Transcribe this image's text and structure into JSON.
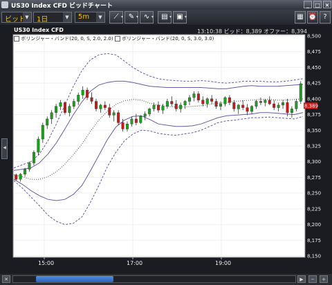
{
  "window": {
    "title": "US30 Index CFD ビッドチャート"
  },
  "toolbar": {
    "price_type": "ビッド",
    "period": "1日",
    "interval": "5m",
    "tools": [
      "trendline-tool",
      "pin-tool",
      "indicator-tool",
      "print-tool",
      "image-tool"
    ]
  },
  "chart": {
    "symbol": "US30 Index CFD",
    "time": "13:10:38",
    "bid": "ビッド：8,389",
    "offer": "オファー：8,394",
    "legend": [
      "ボリンジャー・バンド(20, 0, S, 2.0, 2.0)",
      "ボリンジャー・バンド(20, 0, S, 3.0, 3.0)"
    ],
    "current_price_label": "8,389"
  },
  "chart_data": {
    "type": "candlestick",
    "ylim": [
      8150,
      8500
    ],
    "yticks": [
      "8,500",
      "8,475",
      "8,450",
      "8,425",
      "8,400",
      "8,375",
      "8,350",
      "8,325",
      "8,300",
      "8,275",
      "8,250",
      "8,225",
      "8,200",
      "8,175",
      "8,150"
    ],
    "xticks": [
      "15:00",
      "17:00",
      "19:00"
    ],
    "series": [
      {
        "name": "BB 2.0 upper",
        "values": [
          8286,
          8288,
          8290,
          8298,
          8312,
          8330,
          8352,
          8375,
          8395,
          8412,
          8422,
          8426,
          8428,
          8428,
          8426,
          8423,
          8420,
          8419,
          8418,
          8418,
          8418,
          8418,
          8418,
          8417,
          8416,
          8416,
          8418,
          8420,
          8421,
          8420,
          8420,
          8420,
          8421,
          8422,
          8423
        ]
      },
      {
        "name": "BB 2.0 lower",
        "values": [
          8272,
          8264,
          8254,
          8246,
          8240,
          8238,
          8240,
          8248,
          8262,
          8285,
          8310,
          8335,
          8355,
          8366,
          8372,
          8373,
          8367,
          8360,
          8358,
          8356,
          8356,
          8357,
          8360,
          8365,
          8370,
          8373,
          8374,
          8375,
          8376,
          8378,
          8378,
          8377,
          8376,
          8375,
          8378
        ]
      },
      {
        "name": "BB 3.0 upper",
        "values": [
          8290,
          8295,
          8300,
          8312,
          8333,
          8360,
          8390,
          8420,
          8445,
          8462,
          8470,
          8472,
          8470,
          8460,
          8450,
          8442,
          8436,
          8432,
          8430,
          8429,
          8428,
          8428,
          8429,
          8428,
          8426,
          8425,
          8426,
          8428,
          8428,
          8428,
          8427,
          8427,
          8428,
          8430,
          8432
        ]
      },
      {
        "name": "BB 3.0 lower",
        "values": [
          8270,
          8258,
          8244,
          8230,
          8215,
          8205,
          8200,
          8202,
          8212,
          8235,
          8262,
          8292,
          8315,
          8333,
          8344,
          8350,
          8349,
          8345,
          8343,
          8342,
          8344,
          8346,
          8350,
          8356,
          8362,
          8365,
          8366,
          8368,
          8370,
          8370,
          8371,
          8370,
          8369,
          8368,
          8372
        ]
      },
      {
        "name": "BB middle",
        "values": [
          8279,
          8276,
          8272,
          8272,
          8276,
          8284,
          8296,
          8311,
          8328,
          8348,
          8366,
          8380,
          8391,
          8397,
          8399,
          8398,
          8393,
          8390,
          8388,
          8387,
          8387,
          8388,
          8389,
          8391,
          8393,
          8394,
          8396,
          8397,
          8398,
          8399,
          8399,
          8398,
          8398,
          8399,
          8400
        ]
      }
    ],
    "candles": [
      [
        8279,
        8281,
        8270,
        8272
      ],
      [
        8272,
        8282,
        8268,
        8280
      ],
      [
        8280,
        8290,
        8276,
        8288
      ],
      [
        8288,
        8300,
        8284,
        8298
      ],
      [
        8298,
        8318,
        8294,
        8315
      ],
      [
        8315,
        8340,
        8310,
        8336
      ],
      [
        8336,
        8362,
        8330,
        8358
      ],
      [
        8358,
        8372,
        8352,
        8368
      ],
      [
        8368,
        8382,
        8360,
        8378
      ],
      [
        8378,
        8392,
        8370,
        8388
      ],
      [
        8388,
        8398,
        8382,
        8394
      ],
      [
        8394,
        8396,
        8375,
        8378
      ],
      [
        8378,
        8392,
        8372,
        8388
      ],
      [
        8388,
        8400,
        8384,
        8396
      ],
      [
        8396,
        8410,
        8390,
        8406
      ],
      [
        8406,
        8420,
        8400,
        8414
      ],
      [
        8414,
        8418,
        8398,
        8402
      ],
      [
        8402,
        8410,
        8392,
        8396
      ],
      [
        8396,
        8400,
        8380,
        8384
      ],
      [
        8384,
        8392,
        8378,
        8390
      ],
      [
        8390,
        8396,
        8382,
        8386
      ],
      [
        8386,
        8392,
        8370,
        8374
      ],
      [
        8374,
        8382,
        8364,
        8378
      ],
      [
        8378,
        8382,
        8358,
        8362
      ],
      [
        8362,
        8368,
        8348,
        8352
      ],
      [
        8352,
        8364,
        8348,
        8360
      ],
      [
        8360,
        8372,
        8356,
        8368
      ],
      [
        8368,
        8376,
        8358,
        8362
      ],
      [
        8362,
        8374,
        8360,
        8372
      ],
      [
        8372,
        8380,
        8366,
        8376
      ],
      [
        8376,
        8386,
        8372,
        8384
      ],
      [
        8384,
        8394,
        8380,
        8390
      ],
      [
        8390,
        8396,
        8378,
        8382
      ],
      [
        8382,
        8392,
        8376,
        8388
      ],
      [
        8388,
        8400,
        8384,
        8396
      ],
      [
        8396,
        8404,
        8388,
        8392
      ],
      [
        8392,
        8398,
        8380,
        8384
      ],
      [
        8384,
        8394,
        8378,
        8390
      ],
      [
        8390,
        8398,
        8384,
        8396
      ],
      [
        8396,
        8406,
        8390,
        8402
      ],
      [
        8402,
        8412,
        8396,
        8408
      ],
      [
        8408,
        8412,
        8394,
        8398
      ],
      [
        8398,
        8404,
        8388,
        8392
      ],
      [
        8392,
        8402,
        8386,
        8400
      ],
      [
        8400,
        8406,
        8392,
        8396
      ],
      [
        8396,
        8400,
        8384,
        8388
      ],
      [
        8388,
        8396,
        8382,
        8392
      ],
      [
        8392,
        8404,
        8388,
        8402
      ],
      [
        8402,
        8406,
        8390,
        8394
      ],
      [
        8394,
        8398,
        8380,
        8384
      ],
      [
        8384,
        8392,
        8376,
        8390
      ],
      [
        8390,
        8398,
        8382,
        8386
      ],
      [
        8386,
        8392,
        8374,
        8380
      ],
      [
        8380,
        8390,
        8376,
        8388
      ],
      [
        8388,
        8398,
        8384,
        8396
      ],
      [
        8396,
        8402,
        8390,
        8394
      ],
      [
        8394,
        8400,
        8388,
        8398
      ],
      [
        8398,
        8404,
        8390,
        8392
      ],
      [
        8392,
        8398,
        8382,
        8386
      ],
      [
        8386,
        8394,
        8380,
        8390
      ],
      [
        8390,
        8398,
        8384,
        8394
      ],
      [
        8394,
        8400,
        8372,
        8378
      ],
      [
        8378,
        8388,
        8370,
        8384
      ],
      [
        8384,
        8400,
        8380,
        8396
      ],
      [
        8396,
        8428,
        8392,
        8424
      ]
    ]
  }
}
